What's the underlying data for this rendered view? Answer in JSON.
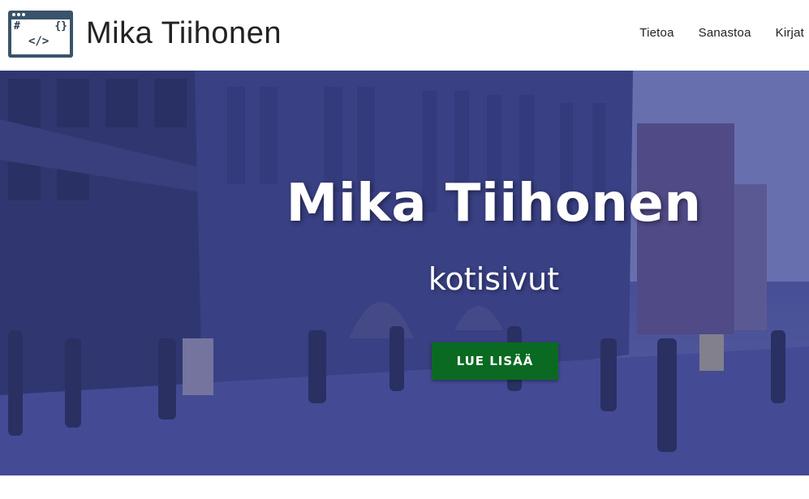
{
  "header": {
    "site_title": "Mika Tiihonen",
    "logo": {
      "icon": "code-window-icon",
      "glyph_hash": "#",
      "glyph_braces": "{}",
      "glyph_tag": "</>"
    },
    "nav": [
      {
        "label": "Tietoa"
      },
      {
        "label": "Sanastoa"
      },
      {
        "label": "Kirjat"
      }
    ]
  },
  "hero": {
    "heading": "Mika Tiihonen",
    "subheading": "kotisivut",
    "cta_label": "LUE LISÄÄ",
    "background_image": "city-street-photo",
    "colors": {
      "overlay": "#4a5296",
      "cta": "#0b6a22",
      "text": "#ffffff"
    }
  }
}
